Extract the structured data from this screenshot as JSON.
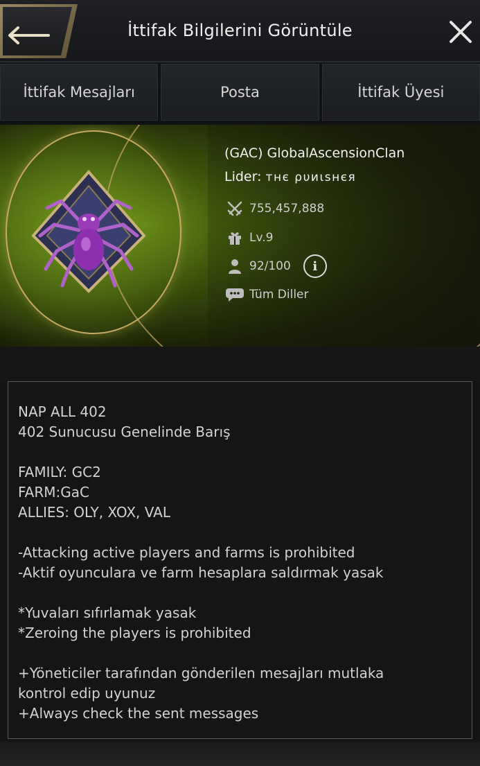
{
  "header": {
    "title": "İttifak Bilgilerini Görüntüle",
    "back_icon": "back-arrow-icon",
    "close_icon": "close-icon"
  },
  "tabs": [
    {
      "label": "İttifak Mesajları"
    },
    {
      "label": "Posta"
    },
    {
      "label": "İttifak Üyesi"
    }
  ],
  "alliance": {
    "name": "(GAC) GlobalAscensionClan",
    "leader_label": "Lider:",
    "leader_value": "ᴛʜє ρυиιѕнєя",
    "power": "755,457,888",
    "level": "Lv.9",
    "members": "92/100",
    "language": "Tüm Diller",
    "emblem": "purple-spider-emblem"
  },
  "description": {
    "lines": [
      "NAP ALL 402",
      "402 Sunucusu Genelinde Barış",
      "",
      "FAMILY: GC2",
      "FARM:GaC",
      "ALLIES: OLY, XOX, VAL",
      "",
      "-Attacking active players and farms is prohibited",
      "-Aktif oyunculara ve farm hesaplara saldırmak yasak",
      "",
      "*Yuvaları sıfırlamak yasak",
      "*Zeroing the players is prohibited",
      "",
      "+Yöneticiler tarafından gönderilen mesajları mutlaka",
      "kontrol edip uyunuz",
      "+Always check the sent messages"
    ]
  },
  "colors": {
    "accent_gold": "#c8a864",
    "banner_green": "#5b7a12",
    "background": "#141414"
  }
}
